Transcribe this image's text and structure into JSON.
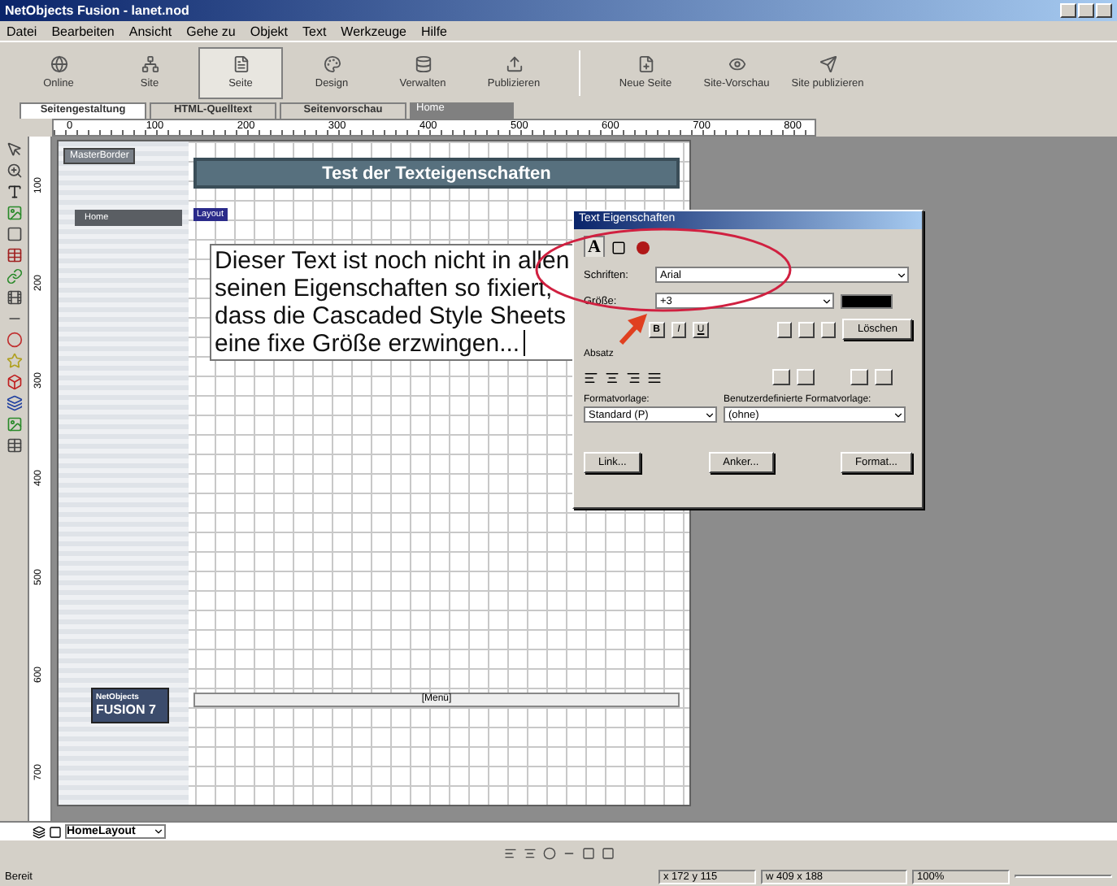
{
  "window": {
    "title": "NetObjects Fusion - lanet.nod"
  },
  "menu": [
    "Datei",
    "Bearbeiten",
    "Ansicht",
    "Gehe zu",
    "Objekt",
    "Text",
    "Werkzeuge",
    "Hilfe"
  ],
  "views": [
    {
      "label": "Online",
      "selected": false
    },
    {
      "label": "Site",
      "selected": false
    },
    {
      "label": "Seite",
      "selected": true
    },
    {
      "label": "Design",
      "selected": false
    },
    {
      "label": "Verwalten",
      "selected": false
    },
    {
      "label": "Publizieren",
      "selected": false
    }
  ],
  "actions": [
    "Neue Seite",
    "Site-Vorschau",
    "Site publizieren"
  ],
  "view_tabs": [
    {
      "label": "Seitengestaltung",
      "selected": true
    },
    {
      "label": "HTML-Quelltext",
      "selected": false
    },
    {
      "label": "Seitenvorschau",
      "selected": false
    }
  ],
  "page_name": "Home",
  "ruler_h": [
    "0",
    "100",
    "200",
    "300",
    "400",
    "500",
    "600",
    "700",
    "800"
  ],
  "ruler_v": [
    "100",
    "200",
    "300",
    "400",
    "500",
    "600",
    "700"
  ],
  "page": {
    "master_border": "MasterBorder",
    "nav_button": "Home",
    "banner": "Test der Texteigenschaften",
    "layout_tag": "Layout",
    "text": "Dieser Text ist noch nicht in allen seinen Eigenschaften so fixiert, dass die Cascaded Style Sheets eine fixe Größe erzwingen...",
    "menu_bar": "[Menü]",
    "logo": [
      "NetObjects",
      "FUSION",
      "7"
    ]
  },
  "dialog": {
    "title": "Text Eigenschaften",
    "tabs": [
      {
        "kind": "text",
        "label": "A",
        "selected": true
      },
      {
        "kind": "box",
        "selected": false
      },
      {
        "kind": "circle",
        "selected": false
      }
    ],
    "font_label": "Schriften:",
    "font": "Arial",
    "size_label": "Größe:",
    "size": "+3",
    "color": "#000000",
    "style_buttons": [
      "B",
      "I",
      "U"
    ],
    "clear": "Löschen",
    "paragraph": "Absatz",
    "style_label": "Formatvorlage:",
    "style": "Standard (P)",
    "custom_label": "Benutzerdefinierte Formatvorlage:",
    "custom": "(ohne)",
    "buttons": [
      "Link...",
      "Anker...",
      "Format..."
    ]
  },
  "layout_name": "HomeLayout",
  "status": {
    "text": "Bereit",
    "position": "x 172  y 115",
    "size": "w 409 x 188",
    "zoom": "100%"
  }
}
